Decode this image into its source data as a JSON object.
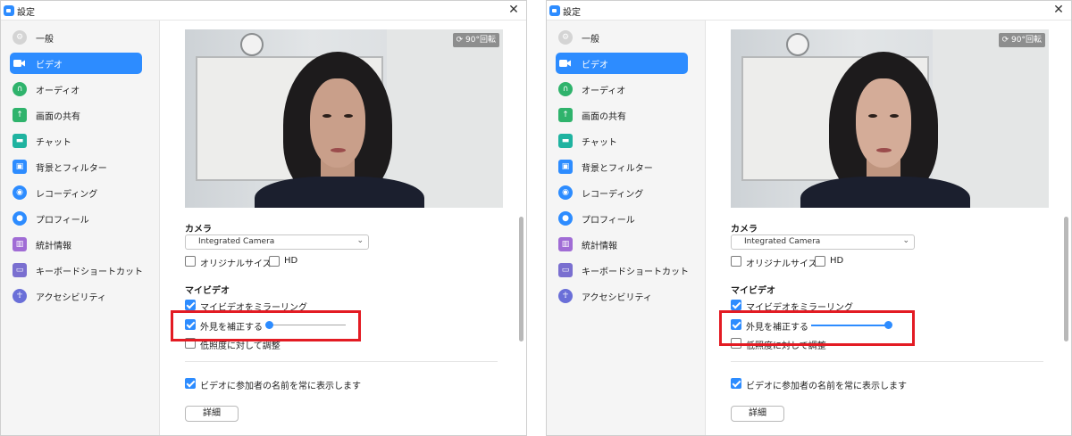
{
  "window": {
    "title": "設定",
    "close": "✕"
  },
  "sidebar": {
    "items": [
      {
        "label": "一般",
        "icon": "gear-icon",
        "color": "#d4d4d4"
      },
      {
        "label": "ビデオ",
        "icon": "video-camera-icon",
        "color": "#ffffff",
        "active": true
      },
      {
        "label": "オーディオ",
        "icon": "headphones-icon",
        "color": "#2fb36c"
      },
      {
        "label": "画面の共有",
        "icon": "share-screen-icon",
        "color": "#2fb36c"
      },
      {
        "label": "チャット",
        "icon": "chat-icon",
        "color": "#1fb3a0"
      },
      {
        "label": "背景とフィルター",
        "icon": "background-icon",
        "color": "#2d8cff"
      },
      {
        "label": "レコーディング",
        "icon": "record-icon",
        "color": "#2d8cff"
      },
      {
        "label": "プロフィール",
        "icon": "profile-icon",
        "color": "#2d8cff"
      },
      {
        "label": "統計情報",
        "icon": "statistics-icon",
        "color": "#a06cd5"
      },
      {
        "label": "キーボードショートカット",
        "icon": "keyboard-icon",
        "color": "#7a6fd0"
      },
      {
        "label": "アクセシビリティ",
        "icon": "accessibility-icon",
        "color": "#6a6fd8"
      }
    ]
  },
  "preview": {
    "rotate_label": "⟳ 90°回転"
  },
  "camera": {
    "section_title": "カメラ",
    "device": "Integrated Camera",
    "original_size": "オリジナルサイズ",
    "hd": "HD"
  },
  "my_video": {
    "section_title": "マイビデオ",
    "mirror": "マイビデオをミラーリング",
    "touch_up": "外見を補正する",
    "low_light": "低照度に対して調整",
    "show_names": "ビデオに参加者の名前を常に表示します"
  },
  "buttons": {
    "advanced": "詳細"
  },
  "touch_up_level": {
    "left_panel": 0.0,
    "right_panel": 1.0
  },
  "colors": {
    "accent": "#2d8cff",
    "highlight": "#e31b23"
  }
}
